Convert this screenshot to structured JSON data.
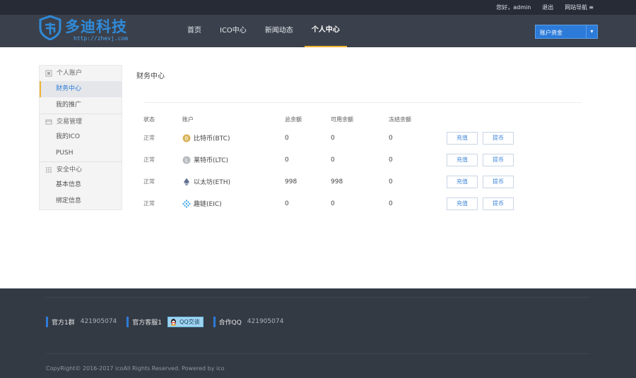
{
  "topbar": {
    "greeting": "您好，admin",
    "logout": "退出",
    "nav_guide": "网站导航"
  },
  "logo": {
    "brand": "多迪科技",
    "url": "http://zhevj.com"
  },
  "nav": [
    {
      "label": "首页",
      "active": false
    },
    {
      "label": "ICO中心",
      "active": false
    },
    {
      "label": "新闻动态",
      "active": false
    },
    {
      "label": "个人中心",
      "active": true
    }
  ],
  "account_select": {
    "value": "账户资金"
  },
  "sidebar": {
    "groups": [
      {
        "title": "个人账户",
        "icon": "user-icon",
        "items": [
          {
            "label": "财务中心",
            "active": true
          },
          {
            "label": "我的推广",
            "active": false
          }
        ]
      },
      {
        "title": "交易管理",
        "icon": "trade-icon",
        "items": [
          {
            "label": "我的ICO",
            "active": false
          },
          {
            "label": "PUSH",
            "active": false
          }
        ]
      },
      {
        "title": "安全中心",
        "icon": "shield-grid-icon",
        "items": [
          {
            "label": "基本信息",
            "active": false
          },
          {
            "label": "绑定信息",
            "active": false
          }
        ]
      }
    ]
  },
  "main": {
    "title": "财务中心"
  },
  "table": {
    "headers": [
      "状态",
      "账户",
      "总余额",
      "可用余额",
      "冻结余额"
    ],
    "rows": [
      {
        "status": "正常",
        "coin": "比特币(BTC)",
        "icon": "btc-icon",
        "total": "0",
        "available": "0",
        "frozen": "0",
        "recharge": "充值",
        "withdraw": "提币"
      },
      {
        "status": "正常",
        "coin": "莱特币(LTC)",
        "icon": "ltc-icon",
        "total": "0",
        "available": "0",
        "frozen": "0",
        "recharge": "充值",
        "withdraw": "提币"
      },
      {
        "status": "正常",
        "coin": "以太坊(ETH)",
        "icon": "eth-icon",
        "total": "998",
        "available": "998",
        "frozen": "0",
        "recharge": "充值",
        "withdraw": "提币"
      },
      {
        "status": "正常",
        "coin": "趣链(EIC)",
        "icon": "eic-icon",
        "total": "0",
        "available": "0",
        "frozen": "0",
        "recharge": "充值",
        "withdraw": "提币"
      }
    ]
  },
  "footer": {
    "contacts": [
      {
        "label": "官方1群",
        "value": "421905074"
      },
      {
        "label": "官方客服1",
        "qq_button": "QQ交谈"
      },
      {
        "label": "合作QQ",
        "value": "421905074"
      }
    ],
    "copyright": "CopyRight© 2016-2017 icoAll Rights Reserved. Powered by ico"
  },
  "colors": {
    "accent": "#f0b230",
    "brand_blue": "#2d7bd8",
    "topbar_bg": "#262b35",
    "header_bg": "#3b414c",
    "footer_bg": "#343a44"
  }
}
